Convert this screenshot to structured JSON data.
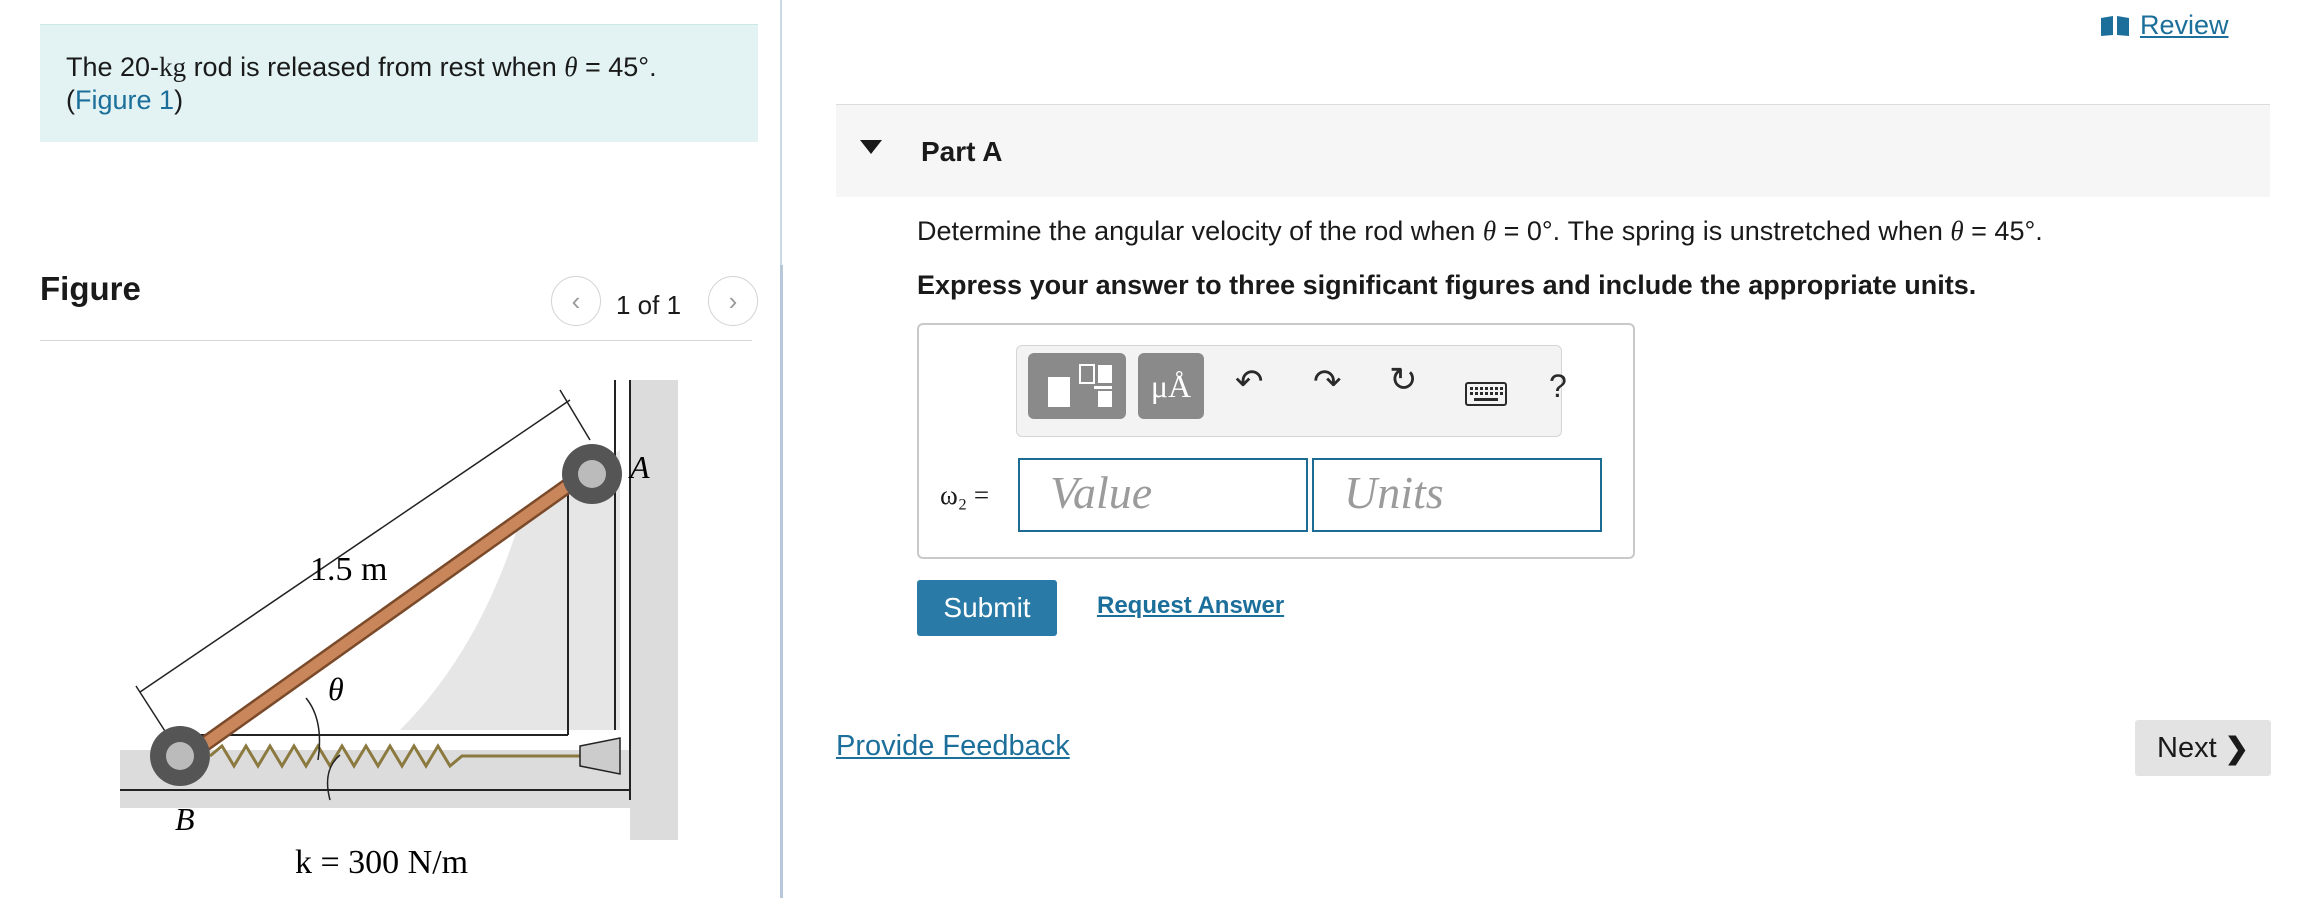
{
  "problem": {
    "text_prefix": "The 20-",
    "mass_unit": "kg",
    "text_mid": " rod is released from rest when ",
    "theta": "θ",
    "text_eq": " = 45°.",
    "figure_link_open": "(",
    "figure_link": "Figure 1",
    "figure_link_close": ")"
  },
  "figure_panel": {
    "title": "Figure",
    "pager_text": "1 of 1",
    "labels": {
      "length": "1.5 m",
      "theta": "θ",
      "point_a": "A",
      "point_b": "B",
      "spring": "k = 300 N/m"
    }
  },
  "header": {
    "review_label": "Review"
  },
  "part": {
    "title": "Part A",
    "question_a": "Determine the angular velocity of the rod when ",
    "question_theta": "θ",
    "question_b": " = 0°. The spring is unstretched when ",
    "question_theta2": "θ",
    "question_c": " = 45°.",
    "instruction": "Express your answer to three significant figures and include the appropriate units."
  },
  "answer": {
    "variable_label": "ω₂ =",
    "value_placeholder": "Value",
    "units_placeholder": "Units",
    "toolbar": {
      "units_button": "μÅ",
      "help": "?"
    }
  },
  "actions": {
    "submit_label": "Submit",
    "request_label": "Request Answer",
    "feedback_label": "Provide Feedback",
    "next_label": "Next"
  },
  "colors": {
    "accent": "#1b6f9a",
    "submit_bg": "#2a7aa7",
    "problem_bg": "#e3f3f3",
    "rod": "#c8865a"
  }
}
